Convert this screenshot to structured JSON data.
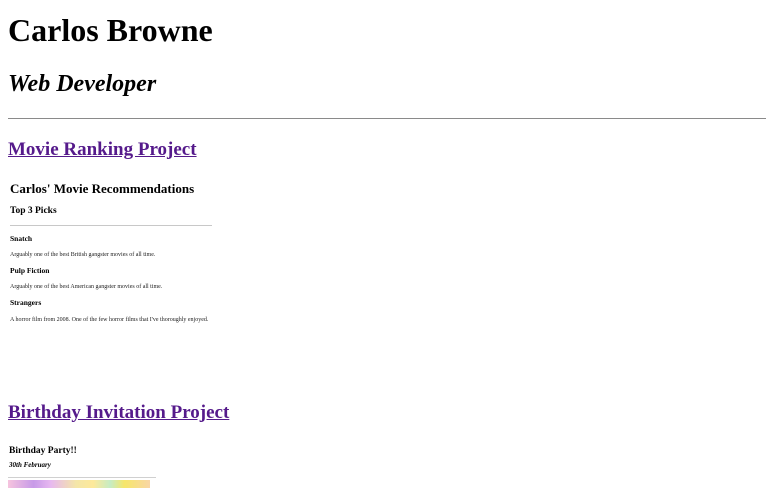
{
  "header": {
    "name": "Carlos Browne",
    "role": "Web Developer"
  },
  "projects": [
    {
      "link_label": "Movie Ranking Project",
      "preview": {
        "title": "Carlos' Movie Recommendations",
        "subtitle": "Top 3 Picks",
        "movies": [
          {
            "title": "Snatch",
            "description": "Arguably one of the best British gangster movies of all time."
          },
          {
            "title": "Pulp Fiction",
            "description": "Arguably one of the best American gangster movies of all time."
          },
          {
            "title": "Strangers",
            "description": "A horror film from 2008. One of the few horror films that I've thoroughly enjoyed."
          }
        ]
      }
    },
    {
      "link_label": "Birthday Invitation Project",
      "preview": {
        "title": "Birthday Party!!",
        "date": "30th February"
      }
    }
  ],
  "colors": {
    "visited_link": "#551a8b",
    "divider": "#8a8a8a"
  }
}
